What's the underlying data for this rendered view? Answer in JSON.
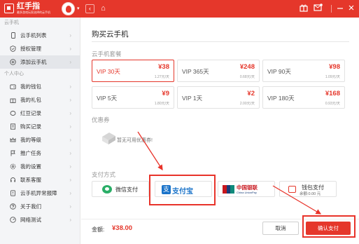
{
  "header": {
    "app_name": "红手指",
    "app_tagline": "最多游戏玩家选择的云手机",
    "back_glyph": "‹",
    "home_glyph": "⌂",
    "icons": [
      "gift-icon",
      "mail-icon",
      "minimize-icon",
      "close-icon"
    ],
    "accent": "#e5372b"
  },
  "sidebar": {
    "section_cloud": "云手机",
    "section_personal": "个人中心",
    "cloud_items": [
      {
        "label": "云手机列表",
        "icon": "phone-icon"
      },
      {
        "label": "授权管理",
        "icon": "shield-icon"
      },
      {
        "label": "添加云手机",
        "icon": "plus-circle-icon",
        "active": true
      }
    ],
    "personal_items": [
      {
        "label": "我的钱包",
        "icon": "wallet-icon"
      },
      {
        "label": "我的礼包",
        "icon": "gift-icon"
      },
      {
        "label": "红豆记录",
        "icon": "bean-icon"
      },
      {
        "label": "购买记录",
        "icon": "receipt-icon"
      },
      {
        "label": "我的等级",
        "icon": "crown-icon"
      },
      {
        "label": "推广任务",
        "icon": "flag-icon"
      },
      {
        "label": "我的设置",
        "icon": "gear-icon"
      },
      {
        "label": "联系客服",
        "icon": "headset-icon"
      },
      {
        "label": "云手机异常报障",
        "icon": "warning-icon"
      },
      {
        "label": "关于我们",
        "icon": "question-icon"
      },
      {
        "label": "网络测试",
        "icon": "network-icon"
      }
    ]
  },
  "main": {
    "title": "购买云手机",
    "plans_label": "云手机套餐",
    "plans": [
      {
        "name": "VIP 30天",
        "price": "¥38",
        "daily": "1.27元/天",
        "selected": true
      },
      {
        "name": "VIP 365天",
        "price": "¥248",
        "daily": "0.68元/天"
      },
      {
        "name": "VIP 90天",
        "price": "¥98",
        "daily": "1.09元/天"
      },
      {
        "name": "VIP 5天",
        "price": "¥9",
        "daily": "1.80元/天"
      },
      {
        "name": "VIP 1天",
        "price": "¥2",
        "daily": "2.00元/天"
      },
      {
        "name": "VIP 180天",
        "price": "¥168",
        "daily": "0.93元/天"
      }
    ],
    "coupon_label": "优惠券",
    "coupon_empty": "暂无可用优惠券!",
    "payment_label": "支付方式",
    "payments": {
      "wechat": "微信支付",
      "alipay": "支付宝",
      "alipay_glyph": "支",
      "unionpay_cn": "中国银联",
      "unionpay_en": "China UnionPay",
      "wallet_name": "钱包支付",
      "wallet_balance": "余额:0.00 元"
    },
    "total_label": "金额:",
    "total_value": "¥38.00",
    "cancel_label": "取消",
    "confirm_label": "确认支付"
  }
}
